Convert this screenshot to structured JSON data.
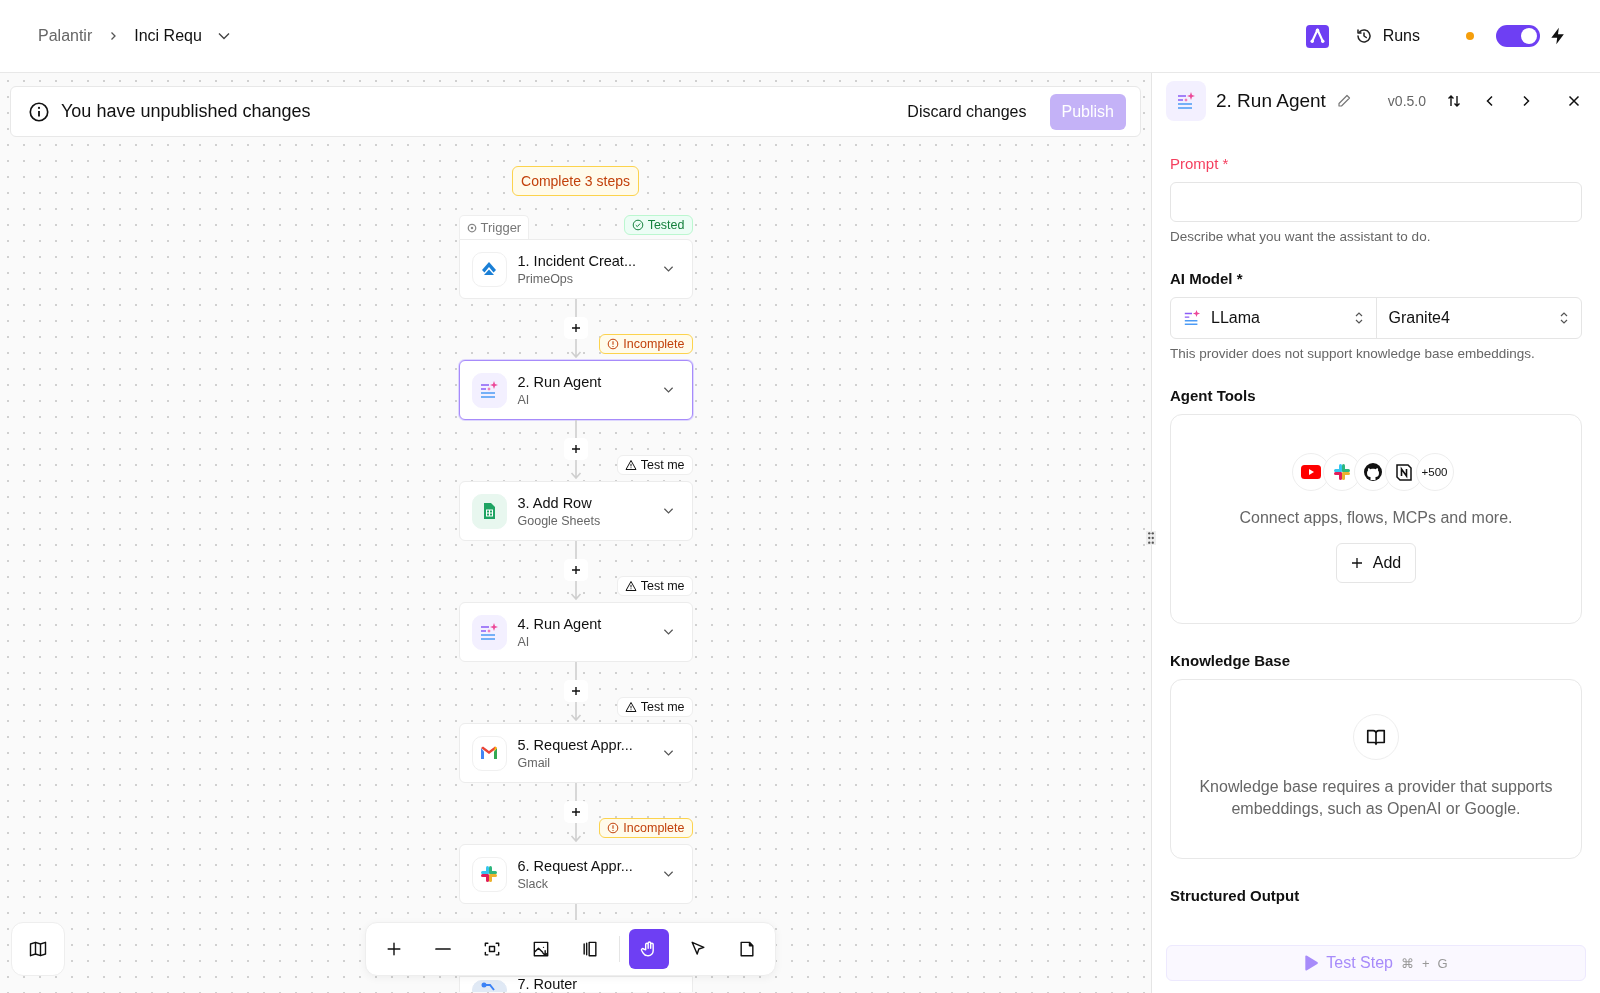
{
  "breadcrumb": {
    "parent": "Palantir",
    "current": "Inci Requ"
  },
  "header": {
    "runs_label": "Runs",
    "toggle_on": true,
    "unsaved_dot": true
  },
  "banner": {
    "message": "You have unpublished changes",
    "discard": "Discard changes",
    "publish": "Publish",
    "publish_disabled": true
  },
  "flow": {
    "summary": "Complete 3 steps",
    "trigger_label": "Trigger",
    "steps": [
      {
        "title": "1. Incident Creat...",
        "app": "PrimeOps",
        "kind": "primeops",
        "tag": {
          "kind": "tested",
          "label": "Tested"
        },
        "selected": false
      },
      {
        "title": "2. Run Agent",
        "app": "AI",
        "kind": "ai",
        "tag": {
          "kind": "incomplete",
          "label": "Incomplete"
        },
        "selected": true
      },
      {
        "title": "3. Add Row",
        "app": "Google Sheets",
        "kind": "sheets",
        "tag": {
          "kind": "untested",
          "label": "Test me"
        },
        "selected": false
      },
      {
        "title": "4. Run Agent",
        "app": "AI",
        "kind": "ai",
        "tag": {
          "kind": "untested",
          "label": "Test me"
        },
        "selected": false
      },
      {
        "title": "5. Request Appr...",
        "app": "Gmail",
        "kind": "gmail",
        "tag": {
          "kind": "untested",
          "label": "Test me"
        },
        "selected": false
      },
      {
        "title": "6. Request Appr...",
        "app": "Slack",
        "kind": "slack",
        "tag": {
          "kind": "incomplete",
          "label": "Incomplete"
        },
        "selected": false
      },
      {
        "title": "7. Router",
        "kind": "router",
        "selected": false
      }
    ]
  },
  "toolbar": [
    {
      "kind": "zoom-in",
      "selected": false
    },
    {
      "kind": "zoom-out",
      "selected": false
    },
    {
      "kind": "fit",
      "selected": false
    },
    {
      "kind": "export-image",
      "selected": false
    },
    {
      "kind": "layout",
      "selected": false
    },
    {
      "kind": "pan",
      "selected": true
    },
    {
      "kind": "select",
      "selected": false
    },
    {
      "kind": "note",
      "selected": false
    }
  ],
  "panel": {
    "title": "2. Run Agent",
    "version": "v0.5.0",
    "prompt": {
      "label": "Prompt *",
      "hint": "Describe what you want the assistant to do."
    },
    "ai_model": {
      "label": "AI Model *",
      "provider": "LLama",
      "model": "Granite4",
      "note": "This provider does not support knowledge base embeddings."
    },
    "agent_tools": {
      "label": "Agent Tools",
      "more_count": "+500",
      "text": "Connect apps, flows, MCPs and more.",
      "add": "Add"
    },
    "knowledge_base": {
      "label": "Knowledge Base",
      "text": "Knowledge base requires a provider that supports embeddings, such as OpenAI or Google."
    },
    "structured_output": {
      "label": "Structured Output"
    },
    "test_step": {
      "label": "Test Step",
      "shortcut_mod": "⌘",
      "shortcut_plus": "+",
      "shortcut_key": "G",
      "disabled": true
    }
  }
}
